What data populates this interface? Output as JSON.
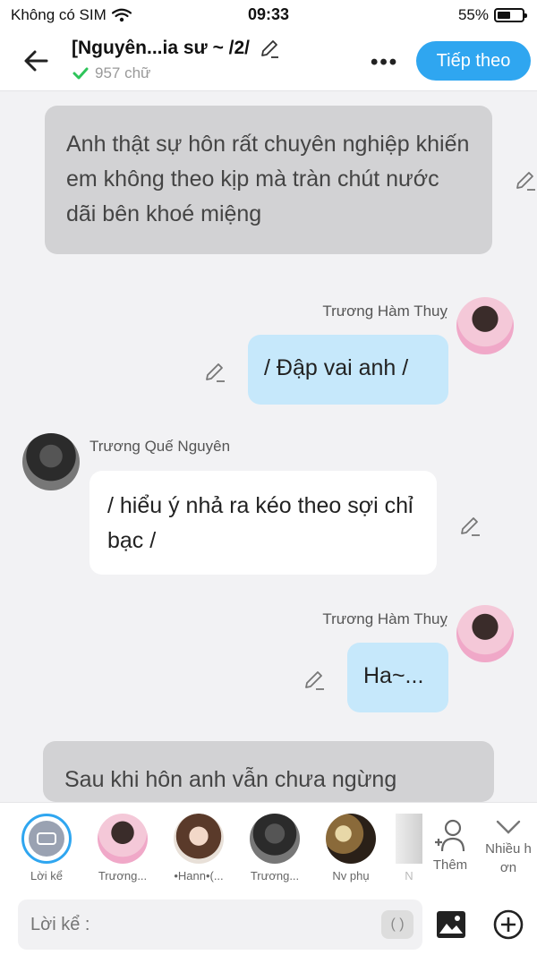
{
  "status_bar": {
    "carrier": "Không có SIM",
    "time": "09:33",
    "battery": "55%",
    "battery_level": 0.55
  },
  "header": {
    "title": "[Nguyên...ia sư ~ /2/",
    "word_count": "957 chữ",
    "more": "•••",
    "next_button": "Tiếp theo"
  },
  "messages": {
    "narration_1": "Anh thật sự hôn rất chuyên nghiệp khiến em không theo kịp mà tràn chút nước dãi bên khoé miệng",
    "me_1": {
      "name": "Trương Hàm Thuỵ",
      "text": "/ Đập vai anh /"
    },
    "them_1": {
      "name": "Trương Quế Nguyên",
      "text": "/ hiểu ý nhả ra kéo theo sợi chỉ bạc /"
    },
    "me_2": {
      "name": "Trương Hàm Thuỵ",
      "text": "Ha~..."
    },
    "narration_2": "Sau khi hôn anh vẫn chưa ngừng"
  },
  "characters": [
    {
      "label": "Lời kể"
    },
    {
      "label": "Trương..."
    },
    {
      "label": "•Hann•(..."
    },
    {
      "label": "Trương..."
    },
    {
      "label": "Nv phụ"
    },
    {
      "label": "N"
    }
  ],
  "actions": {
    "add_label": "Thêm",
    "more_label_1": "Nhiều h",
    "more_label_2": "ơn"
  },
  "input": {
    "placeholder": "Lời kể :",
    "paren": "( )"
  },
  "colors": {
    "accent": "#2fa6f0",
    "me_bubble": "#c6e8fb",
    "narration_bubble": "#d2d2d4"
  }
}
